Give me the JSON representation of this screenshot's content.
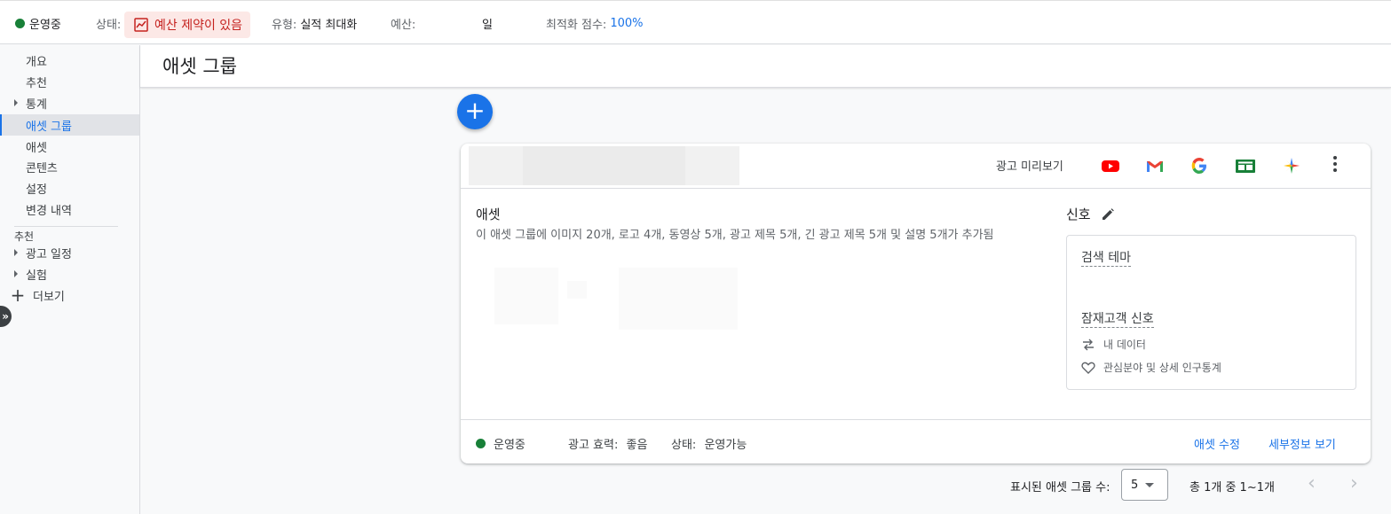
{
  "topbar": {
    "status_running": "운영중",
    "status_label": "상태:",
    "status_value": "예산 제약이 있음",
    "type_label": "유형:",
    "type_value": "실적 최대화",
    "budget_label": "예산:",
    "budget_unit": "일",
    "opt_label": "최적화 점수:",
    "opt_value": "100%"
  },
  "sidebar": {
    "items": [
      {
        "label": "개요"
      },
      {
        "label": "추천"
      },
      {
        "label": "통계"
      },
      {
        "label": "애셋 그룹"
      },
      {
        "label": "애셋"
      },
      {
        "label": "콘텐츠"
      },
      {
        "label": "설정"
      },
      {
        "label": "변경 내역"
      }
    ],
    "section_label": "추천",
    "section_items": [
      {
        "label": "광고 일정"
      },
      {
        "label": "실험"
      }
    ],
    "more_label": "더보기"
  },
  "page": {
    "title": "애셋 그룹"
  },
  "card": {
    "preview_label": "광고 미리보기",
    "channels": [
      "youtube-icon",
      "gmail-icon",
      "google-icon",
      "display-icon",
      "discover-icon"
    ],
    "assets_title": "애셋",
    "assets_desc": "이 애셋 그룹에 이미지 20개, 로고 4개, 동영상 5개, 광고 제목 5개, 긴 광고 제목 5개 및 설명 5개가 추가됨",
    "signals_title": "신호",
    "search_themes": "검색 테마",
    "audience_signal": "잠재고객 신호",
    "my_data": "내 데이터",
    "interests": "관심분야 및 상세 인구통계",
    "footer": {
      "status": "운영중",
      "ad_strength_label": "광고 효력:",
      "ad_strength_value": "좋음",
      "state_label": "상태:",
      "state_value": "운영가능",
      "edit_assets": "애셋 수정",
      "view_details": "세부정보 보기"
    }
  },
  "pagination": {
    "label": "표시된 애셋 그룹 수:",
    "page_size": "5",
    "count": "총 1개 중 1~1개"
  },
  "colors": {
    "accent": "#1a73e8",
    "running": "#188038",
    "limited_bg": "#fce8e6",
    "limited_text": "#c5221f"
  }
}
